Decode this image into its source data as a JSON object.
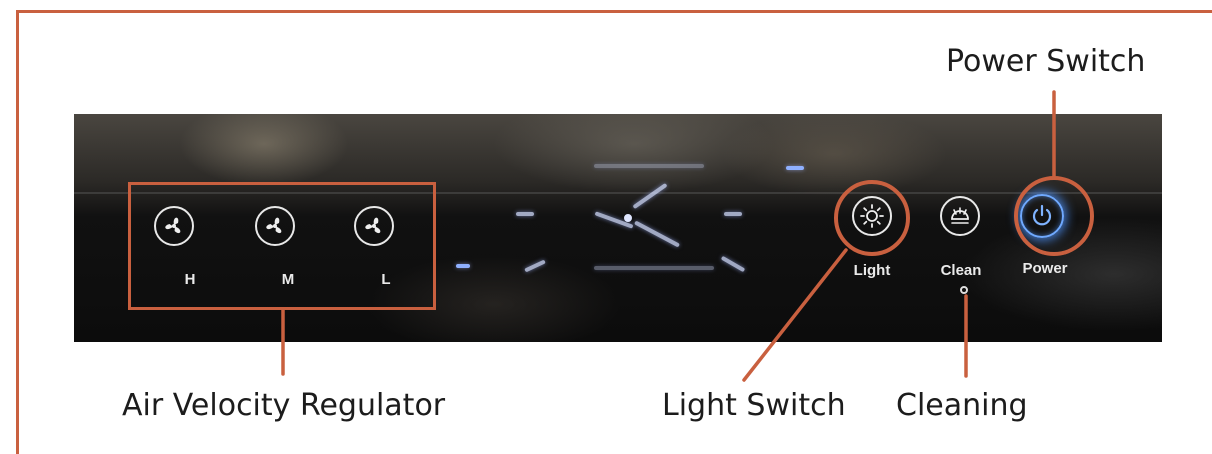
{
  "callouts": {
    "power_switch": "Power Switch",
    "air_velocity": "Air Velocity Regulator",
    "light_switch": "Light Switch",
    "cleaning": "Cleaning"
  },
  "panel": {
    "fan_keys": [
      {
        "label": "H",
        "icon": "fan-icon"
      },
      {
        "label": "M",
        "icon": "fan-icon"
      },
      {
        "label": "L",
        "icon": "fan-icon"
      }
    ],
    "light_key": {
      "label": "Light",
      "icon": "sun-icon"
    },
    "clean_key": {
      "label": "Clean",
      "icon": "cleaning-icon"
    },
    "power_key": {
      "label": "Power",
      "icon": "power-icon"
    }
  },
  "colors": {
    "accent": "#c9603f",
    "power_glow": "#6fa9ff",
    "panel": "#0c0c0c"
  }
}
